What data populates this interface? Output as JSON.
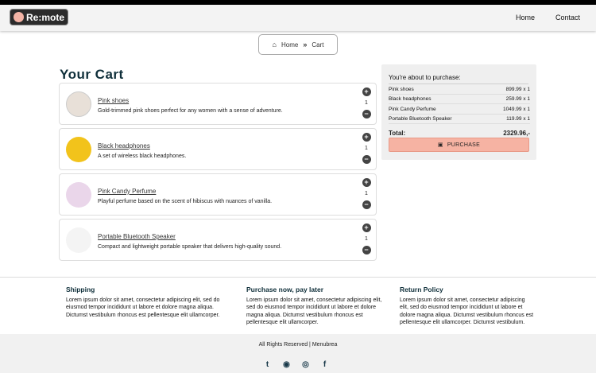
{
  "brand": {
    "name": "Re:mote"
  },
  "nav": {
    "home": "Home",
    "contact": "Contact"
  },
  "breadcrumb": {
    "home": "Home",
    "sep": "»",
    "current": "Cart"
  },
  "cart": {
    "title": "Your Cart",
    "items": [
      {
        "name": "Pink shoes",
        "desc": "Gold-trimmed pink shoes perfect for any women with a sense of adventure.",
        "qty": "1",
        "thumb_color": "#e8e0d8"
      },
      {
        "name": "Black headphones",
        "desc": "A set of wireless black headphones.",
        "qty": "1",
        "thumb_color": "#f2c31b"
      },
      {
        "name": "Pink Candy Perfume",
        "desc": "Playful perfume based on the scent of hibiscus with nuances of vanilla.",
        "qty": "1",
        "thumb_color": "#ead6ea"
      },
      {
        "name": "Portable Bluetooth Speaker",
        "desc": "Compact and lightweight portable speaker that delivers high-quality sound.",
        "qty": "1",
        "thumb_color": "#f4f4f4"
      }
    ]
  },
  "summary": {
    "title": "You're about to purchase:",
    "rows": [
      {
        "name": "Pink shoes",
        "price": "899.99 x 1"
      },
      {
        "name": "Black headphones",
        "price": "259.99 x 1"
      },
      {
        "name": "Pink Candy Perfume",
        "price": "1049.99 x 1"
      },
      {
        "name": "Portable Bluetooth Speaker",
        "price": "119.99 x 1"
      }
    ],
    "total_label": "Total:",
    "total_value": "2329.96,-",
    "purchase": "PURCHASE"
  },
  "info": [
    {
      "title": "Shipping",
      "text": "Lorem ipsum dolor sit amet, consectetur adipiscing elit, sed do eiusmod tempor incididunt ut labore et dolore magna aliqua. Dictumst vestibulum rhoncus est pellentesque elit ullamcorper."
    },
    {
      "title": "Purchase now, pay later",
      "text": "Lorem ipsum dolor sit amet, consectetur adipiscing elit, sed do eiusmod tempor incididunt ut labore et dolore magna aliqua. Dictumst vestibulum rhoncus est pellentesque elit ullamcorper."
    },
    {
      "title": "Return Policy",
      "text": "Lorem ipsum dolor sit amet, consectetur adipiscing elit, sed do eiusmod tempor incididunt ut labore et dolore magna aliqua. Dictumst vestibulum rhoncus est pellentesque elit ullamcorper. Dictumst vestibulum."
    }
  ],
  "footer": {
    "rights": "All Rights Reserved | Menubrea"
  },
  "icons": {
    "twitter": "twitter-icon",
    "reddit": "reddit-icon",
    "instagram": "instagram-icon",
    "facebook": "facebook-icon"
  }
}
